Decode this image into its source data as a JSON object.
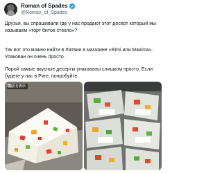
{
  "author": {
    "display_name": "Roman of Spades",
    "handle": "@Roman_of_Spades"
  },
  "post": {
    "paragraph_1": "Друзья, вы спрашивали где у нас продают этот десерт который мы называем «торт битое стекло»?",
    "paragraph_2": "Так вот это можно найти в Латвии в магазине «Rimi или Maxima». Упакован он очень просто.",
    "paragraph_3": "Порой самые вкусные десерты упакованы слишком просто. Если будете у нас в Риге, попробуйте."
  },
  "media": {
    "translate_badge": "翻訳を表示",
    "image_left_alt": "cake-with-colored-jelly-pieces",
    "image_right_alt": "packaged-desserts-in-store-shelf"
  },
  "colors": {
    "verified_blue": "#1d9bf0",
    "text_secondary": "#536471"
  }
}
